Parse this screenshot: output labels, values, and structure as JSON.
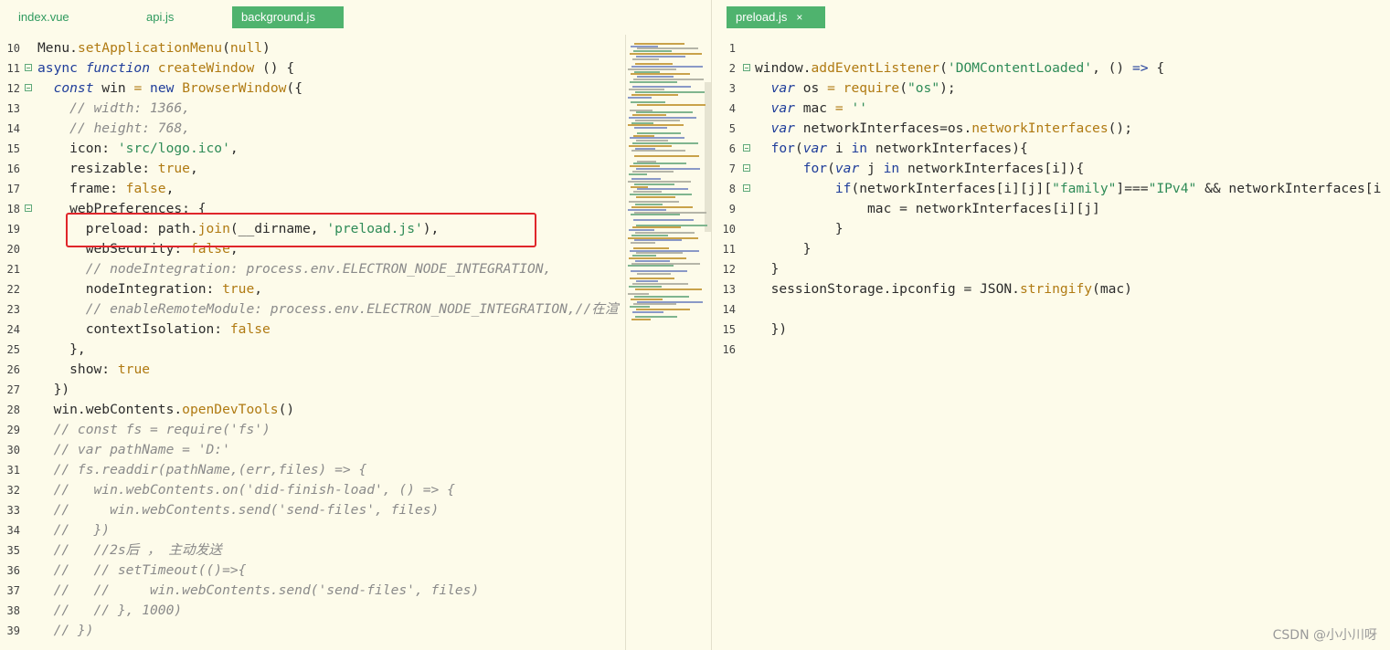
{
  "left_tabs": [
    {
      "label": "index.vue"
    },
    {
      "label": "api.js"
    },
    {
      "label": "background.js"
    }
  ],
  "right_tabs": [
    {
      "label": "preload.js",
      "close": "×"
    }
  ],
  "left_lines": [
    {
      "n": "10",
      "fold": false,
      "tokens": [
        [
          "",
          "Menu."
        ],
        [
          "fn",
          "setApplicationMenu"
        ],
        [
          "",
          "("
        ],
        [
          "lit",
          "null"
        ],
        [
          "",
          ")"
        ]
      ]
    },
    {
      "n": "11",
      "fold": true,
      "tokens": [
        [
          "kw2",
          "async "
        ],
        [
          "kw",
          "function "
        ],
        [
          "fn",
          "createWindow"
        ],
        [
          "",
          " () {"
        ]
      ]
    },
    {
      "n": "12",
      "fold": true,
      "tokens": [
        [
          "",
          "  "
        ],
        [
          "kw",
          "const "
        ],
        [
          "",
          "win "
        ],
        [
          "fn",
          "= "
        ],
        [
          "kw2",
          "new "
        ],
        [
          "fn",
          "BrowserWindow"
        ],
        [
          "",
          "({"
        ]
      ]
    },
    {
      "n": "13",
      "fold": false,
      "tokens": [
        [
          "",
          "    "
        ],
        [
          "cmt",
          "// width: 1366,"
        ]
      ]
    },
    {
      "n": "14",
      "fold": false,
      "tokens": [
        [
          "",
          "    "
        ],
        [
          "cmt",
          "// height: 768,"
        ]
      ]
    },
    {
      "n": "15",
      "fold": false,
      "tokens": [
        [
          "",
          "    icon: "
        ],
        [
          "str",
          "'src/logo.ico'"
        ],
        [
          "",
          ","
        ]
      ]
    },
    {
      "n": "16",
      "fold": false,
      "tokens": [
        [
          "",
          "    resizable: "
        ],
        [
          "lit",
          "true"
        ],
        [
          "",
          ","
        ]
      ]
    },
    {
      "n": "17",
      "fold": false,
      "tokens": [
        [
          "",
          "    frame: "
        ],
        [
          "lit",
          "false"
        ],
        [
          "",
          ","
        ]
      ]
    },
    {
      "n": "18",
      "fold": true,
      "tokens": [
        [
          "",
          "    webPreferences: {"
        ]
      ]
    },
    {
      "n": "19",
      "fold": false,
      "tokens": [
        [
          "",
          "      preload: path."
        ],
        [
          "fn",
          "join"
        ],
        [
          "",
          "(__dirname, "
        ],
        [
          "str",
          "'preload.js'"
        ],
        [
          "",
          "),"
        ]
      ]
    },
    {
      "n": "20",
      "fold": false,
      "tokens": [
        [
          "",
          "      webSecurity: "
        ],
        [
          "lit",
          "false"
        ],
        [
          "",
          ","
        ]
      ]
    },
    {
      "n": "21",
      "fold": false,
      "tokens": [
        [
          "",
          "      "
        ],
        [
          "cmt",
          "// nodeIntegration: process.env.ELECTRON_NODE_INTEGRATION,"
        ]
      ]
    },
    {
      "n": "22",
      "fold": false,
      "tokens": [
        [
          "",
          "      nodeIntegration: "
        ],
        [
          "lit",
          "true"
        ],
        [
          "",
          ","
        ]
      ]
    },
    {
      "n": "23",
      "fold": false,
      "tokens": [
        [
          "",
          "      "
        ],
        [
          "cmt",
          "// enableRemoteModule: process.env.ELECTRON_NODE_INTEGRATION,//在渲"
        ]
      ]
    },
    {
      "n": "24",
      "fold": false,
      "tokens": [
        [
          "",
          "      contextIsolation: "
        ],
        [
          "lit",
          "false"
        ]
      ]
    },
    {
      "n": "25",
      "fold": false,
      "tokens": [
        [
          "",
          "    },"
        ]
      ]
    },
    {
      "n": "26",
      "fold": false,
      "tokens": [
        [
          "",
          "    show: "
        ],
        [
          "lit",
          "true"
        ]
      ]
    },
    {
      "n": "27",
      "fold": false,
      "tokens": [
        [
          "",
          "  })"
        ]
      ]
    },
    {
      "n": "28",
      "fold": false,
      "tokens": [
        [
          "",
          "  win.webContents."
        ],
        [
          "fn",
          "openDevTools"
        ],
        [
          "",
          "()"
        ]
      ]
    },
    {
      "n": "29",
      "fold": false,
      "tokens": [
        [
          "",
          "  "
        ],
        [
          "cmt",
          "// const fs = require('fs')"
        ]
      ]
    },
    {
      "n": "30",
      "fold": false,
      "tokens": [
        [
          "",
          "  "
        ],
        [
          "cmt",
          "// var pathName = 'D:'"
        ]
      ]
    },
    {
      "n": "31",
      "fold": false,
      "tokens": [
        [
          "",
          "  "
        ],
        [
          "cmt",
          "// fs.readdir(pathName,(err,files) => {"
        ]
      ]
    },
    {
      "n": "32",
      "fold": false,
      "tokens": [
        [
          "",
          "  "
        ],
        [
          "cmt",
          "//   win.webContents.on('did-finish-load', () => {"
        ]
      ]
    },
    {
      "n": "33",
      "fold": false,
      "tokens": [
        [
          "",
          "  "
        ],
        [
          "cmt",
          "//     win.webContents.send('send-files', files)"
        ]
      ]
    },
    {
      "n": "34",
      "fold": false,
      "tokens": [
        [
          "",
          "  "
        ],
        [
          "cmt",
          "//   })"
        ]
      ]
    },
    {
      "n": "35",
      "fold": false,
      "tokens": [
        [
          "",
          "  "
        ],
        [
          "cmt",
          "//   //2s后 ， 主动发送"
        ]
      ]
    },
    {
      "n": "36",
      "fold": false,
      "tokens": [
        [
          "",
          "  "
        ],
        [
          "cmt",
          "//   // setTimeout(()=>{"
        ]
      ]
    },
    {
      "n": "37",
      "fold": false,
      "tokens": [
        [
          "",
          "  "
        ],
        [
          "cmt",
          "//   //     win.webContents.send('send-files', files)"
        ]
      ]
    },
    {
      "n": "38",
      "fold": false,
      "tokens": [
        [
          "",
          "  "
        ],
        [
          "cmt",
          "//   // }, 1000)"
        ]
      ]
    },
    {
      "n": "39",
      "fold": false,
      "tokens": [
        [
          "",
          "  "
        ],
        [
          "cmt",
          "// })"
        ]
      ]
    }
  ],
  "right_lines": [
    {
      "n": "1",
      "fold": false,
      "tokens": []
    },
    {
      "n": "2",
      "fold": true,
      "tokens": [
        [
          "",
          "window."
        ],
        [
          "fn",
          "addEventListener"
        ],
        [
          "",
          "("
        ],
        [
          "str",
          "'DOMContentLoaded'"
        ],
        [
          "",
          ", () "
        ],
        [
          "kw2",
          "=>"
        ],
        [
          "",
          " {"
        ]
      ]
    },
    {
      "n": "3",
      "fold": false,
      "tokens": [
        [
          "",
          "  "
        ],
        [
          "kw",
          "var "
        ],
        [
          "",
          "os "
        ],
        [
          "fn",
          "= "
        ],
        [
          "fn",
          "require"
        ],
        [
          "",
          "("
        ],
        [
          "str",
          "\"os\""
        ],
        [
          "",
          ");"
        ]
      ]
    },
    {
      "n": "4",
      "fold": false,
      "tokens": [
        [
          "",
          "  "
        ],
        [
          "kw",
          "var "
        ],
        [
          "",
          "mac "
        ],
        [
          "fn",
          "= "
        ],
        [
          "str",
          "''"
        ]
      ]
    },
    {
      "n": "5",
      "fold": false,
      "tokens": [
        [
          "",
          "  "
        ],
        [
          "kw",
          "var "
        ],
        [
          "",
          "networkInterfaces=os."
        ],
        [
          "fn",
          "networkInterfaces"
        ],
        [
          "",
          "();"
        ]
      ]
    },
    {
      "n": "6",
      "fold": true,
      "tokens": [
        [
          "",
          "  "
        ],
        [
          "kw2",
          "for"
        ],
        [
          "",
          "("
        ],
        [
          "kw",
          "var "
        ],
        [
          "",
          "i "
        ],
        [
          "kw2",
          "in "
        ],
        [
          "",
          "networkInterfaces){"
        ]
      ]
    },
    {
      "n": "7",
      "fold": true,
      "tokens": [
        [
          "",
          "      "
        ],
        [
          "kw2",
          "for"
        ],
        [
          "",
          "("
        ],
        [
          "kw",
          "var "
        ],
        [
          "",
          "j "
        ],
        [
          "kw2",
          "in "
        ],
        [
          "",
          "networkInterfaces[i]){"
        ]
      ]
    },
    {
      "n": "8",
      "fold": true,
      "tokens": [
        [
          "",
          "          "
        ],
        [
          "kw2",
          "if"
        ],
        [
          "",
          "(networkInterfaces[i][j]["
        ],
        [
          "str",
          "\"family\""
        ],
        [
          "",
          "]==="
        ],
        [
          "str",
          "\"IPv4\""
        ],
        [
          "",
          " && networkInterfaces[i"
        ]
      ]
    },
    {
      "n": "9",
      "fold": false,
      "tokens": [
        [
          "",
          "              mac = networkInterfaces[i][j]"
        ]
      ]
    },
    {
      "n": "10",
      "fold": false,
      "tokens": [
        [
          "",
          "          }"
        ]
      ]
    },
    {
      "n": "11",
      "fold": false,
      "tokens": [
        [
          "",
          "      }"
        ]
      ]
    },
    {
      "n": "12",
      "fold": false,
      "tokens": [
        [
          "",
          "  }"
        ]
      ]
    },
    {
      "n": "13",
      "fold": false,
      "tokens": [
        [
          "",
          "  sessionStorage.ipconfig = JSON."
        ],
        [
          "fn",
          "stringify"
        ],
        [
          "",
          "(mac)"
        ]
      ]
    },
    {
      "n": "14",
      "fold": false,
      "tokens": []
    },
    {
      "n": "15",
      "fold": false,
      "tokens": [
        [
          "",
          "  })"
        ]
      ]
    },
    {
      "n": "16",
      "fold": false,
      "tokens": []
    }
  ],
  "colors": {
    "background": "#fdfbea",
    "tab_active": "#4fb36e",
    "highlight_box": "#e0262b"
  },
  "watermark": "CSDN @小小川呀"
}
